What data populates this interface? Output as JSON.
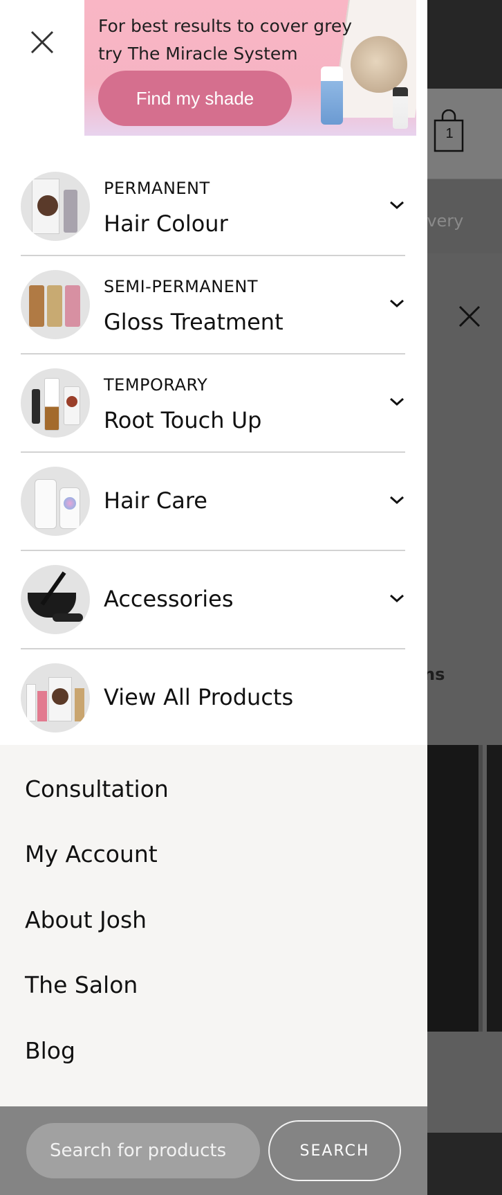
{
  "promo": {
    "text": "For best results to cover grey try The Miracle System",
    "button_label": "Find my shade"
  },
  "categories": [
    {
      "subtitle": "PERMANENT",
      "title": "Hair Colour",
      "thumb_icon": "hair-colour-kit-icon"
    },
    {
      "subtitle": "SEMI-PERMANENT",
      "title": "Gloss Treatment",
      "thumb_icon": "gloss-tubes-icon"
    },
    {
      "subtitle": "TEMPORARY",
      "title": "Root Touch Up",
      "thumb_icon": "root-touch-up-icon"
    },
    {
      "subtitle": "",
      "title": "Hair Care",
      "thumb_icon": "hair-care-bottles-icon"
    },
    {
      "subtitle": "",
      "title": "Accessories",
      "thumb_icon": "brush-bowl-icon"
    },
    {
      "subtitle": "",
      "title": "View All Products",
      "thumb_icon": "all-products-icon"
    }
  ],
  "links": [
    "Consultation",
    "My Account",
    "About Josh",
    "The Salon",
    "Blog"
  ],
  "search": {
    "placeholder": "Search for products",
    "button_label": "SEARCH"
  },
  "background": {
    "cart_count": "1",
    "delivery_fragment": "livery",
    "heading_fragment": "ns"
  },
  "colors": {
    "promo_button": "#d56f8e",
    "promo_bg": "#f9b6c5",
    "links_bg": "#f6f5f3",
    "search_bar": "#848484"
  }
}
